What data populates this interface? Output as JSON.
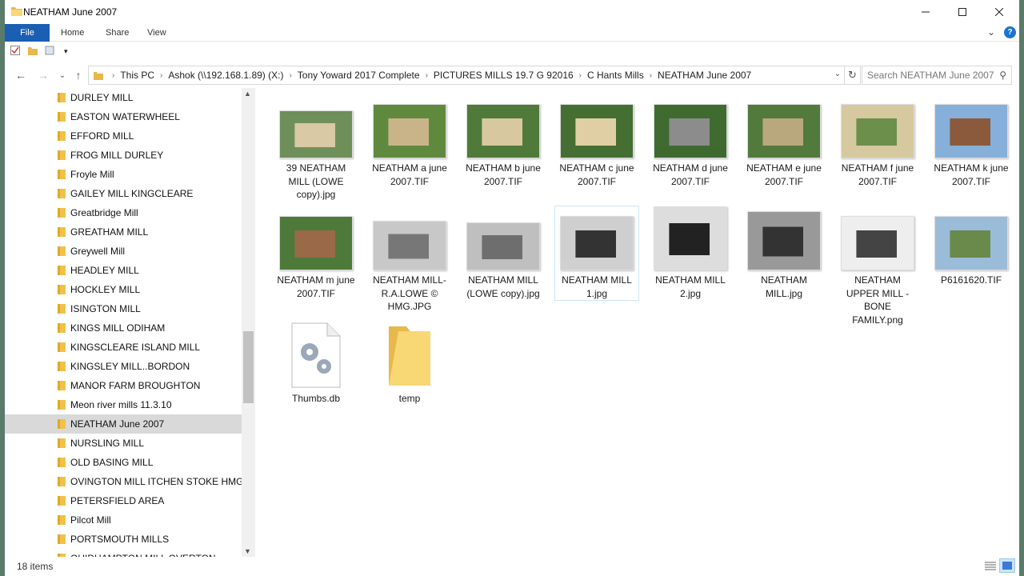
{
  "window": {
    "title": "NEATHAM June 2007"
  },
  "ribbon": {
    "tabs": [
      "File",
      "Home",
      "Share",
      "View"
    ]
  },
  "address": {
    "crumbs": [
      "This PC",
      "Ashok (\\\\192.168.1.89) (X:)",
      "Tony Yoward 2017 Complete",
      "PICTURES MILLS 19.7 G 92016",
      "C Hants Mills",
      "NEATHAM June 2007"
    ],
    "search_placeholder": "Search NEATHAM June 2007"
  },
  "nav": {
    "items": [
      "DURLEY MILL",
      "EASTON WATERWHEEL",
      "EFFORD MILL",
      "FROG MILL DURLEY",
      "Froyle Mill",
      "GAILEY  MILL  KINGCLEARE",
      "Greatbridge Mill",
      "GREATHAM MILL",
      "Greywell Mill",
      "HEADLEY MILL",
      "HOCKLEY MILL",
      "ISINGTON MILL",
      "KINGS MILL  ODIHAM",
      "KINGSCLEARE ISLAND MILL",
      "KINGSLEY MILL..BORDON",
      "MANOR FARM BROUGHTON",
      "Meon river mills 11.3.10",
      "NEATHAM June 2007",
      "NURSLING MILL",
      "OLD  BASING  MILL",
      "OVINGTON MILL ITCHEN STOKE HMG VI",
      "PETERSFIELD  AREA",
      "Pilcot Mill",
      "PORTSMOUTH MILLS",
      "QUIDHAMPTON MILL    OVERTON"
    ],
    "selected_index": 17
  },
  "files": [
    {
      "name": "39 NEATHAM MILL (LOWE copy).jpg",
      "kind": "bw"
    },
    {
      "name": "NEATHAM  a june 2007.TIF",
      "kind": "color"
    },
    {
      "name": "NEATHAM  b june 2007.TIF",
      "kind": "color"
    },
    {
      "name": "NEATHAM  c june 2007.TIF",
      "kind": "color"
    },
    {
      "name": "NEATHAM  d june 2007.TIF",
      "kind": "color"
    },
    {
      "name": "NEATHAM  e june 2007.TIF",
      "kind": "color"
    },
    {
      "name": "NEATHAM  f june 2007.TIF",
      "kind": "color"
    },
    {
      "name": "NEATHAM  k june 2007.TIF",
      "kind": "color"
    },
    {
      "name": "NEATHAM  m june 2007.TIF",
      "kind": "color"
    },
    {
      "name": "NEATHAM  MILL-R.A.LOWE  © HMG.JPG",
      "kind": "bw"
    },
    {
      "name": "NEATHAM MILL (LOWE copy).jpg",
      "kind": "bw"
    },
    {
      "name": "NEATHAM MILL 1.jpg",
      "kind": "bw"
    },
    {
      "name": "NEATHAM MILL 2.jpg",
      "kind": "bw"
    },
    {
      "name": "NEATHAM MILL.jpg",
      "kind": "bw"
    },
    {
      "name": "NEATHAM UPPER MILL - BONE FAMILY.png",
      "kind": "bw"
    },
    {
      "name": "P6161620.TIF",
      "kind": "color"
    },
    {
      "name": "Thumbs.db",
      "kind": "db"
    },
    {
      "name": "temp",
      "kind": "folder"
    }
  ],
  "status": {
    "count": "18 items"
  },
  "colors": {
    "accent": "#1a5fb4",
    "selection": "#cce4f7",
    "folder": "#f8d775"
  }
}
